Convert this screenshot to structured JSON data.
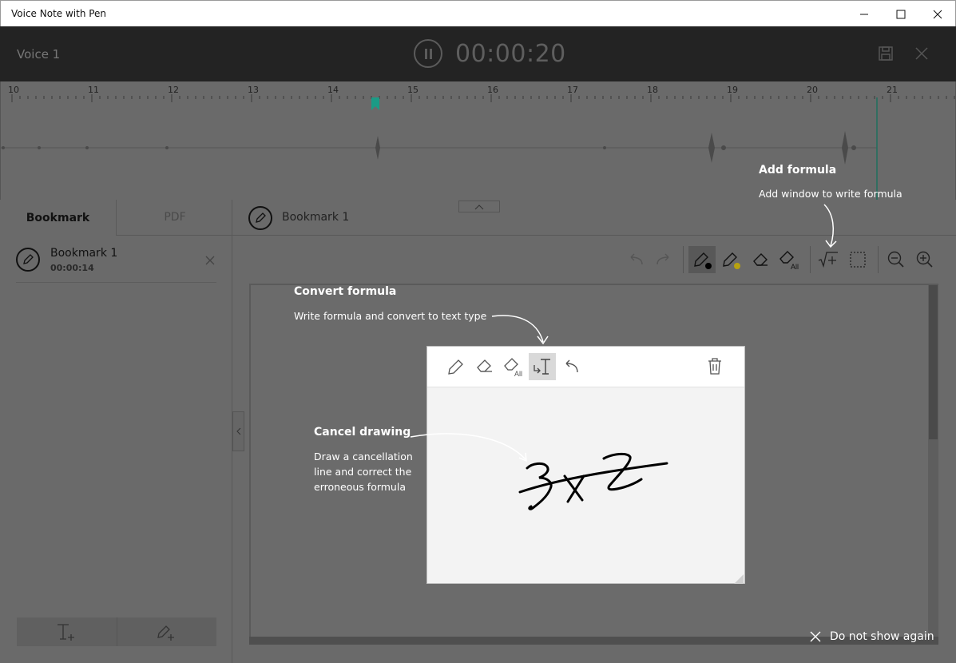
{
  "window": {
    "title": "Voice Note with Pen"
  },
  "recorder": {
    "name": "Voice 1",
    "time": "00:00:20"
  },
  "timeline": {
    "ticks": [
      "10",
      "11",
      "12",
      "13",
      "14",
      "15",
      "16",
      "17",
      "18",
      "19",
      "20",
      "21"
    ]
  },
  "sidebar": {
    "tabs": [
      "Bookmark",
      "PDF"
    ],
    "bookmark": {
      "title": "Bookmark 1",
      "time": "00:00:14"
    }
  },
  "main": {
    "title": "Bookmark 1"
  },
  "callouts": {
    "add_formula": {
      "title": "Add formula",
      "text": "Add window to write formula"
    },
    "convert_formula": {
      "title": "Convert formula",
      "text": "Write formula and convert to text type"
    },
    "cancel_drawing": {
      "title": "Cancel drawing",
      "line1": "Draw a cancellation",
      "line2": "line and correct the",
      "line3": "erroneous formula"
    }
  },
  "dont_show": "Do not show again",
  "colors": {
    "accent_marker": "#1b9b86",
    "overlay": "#6a6a6a"
  }
}
